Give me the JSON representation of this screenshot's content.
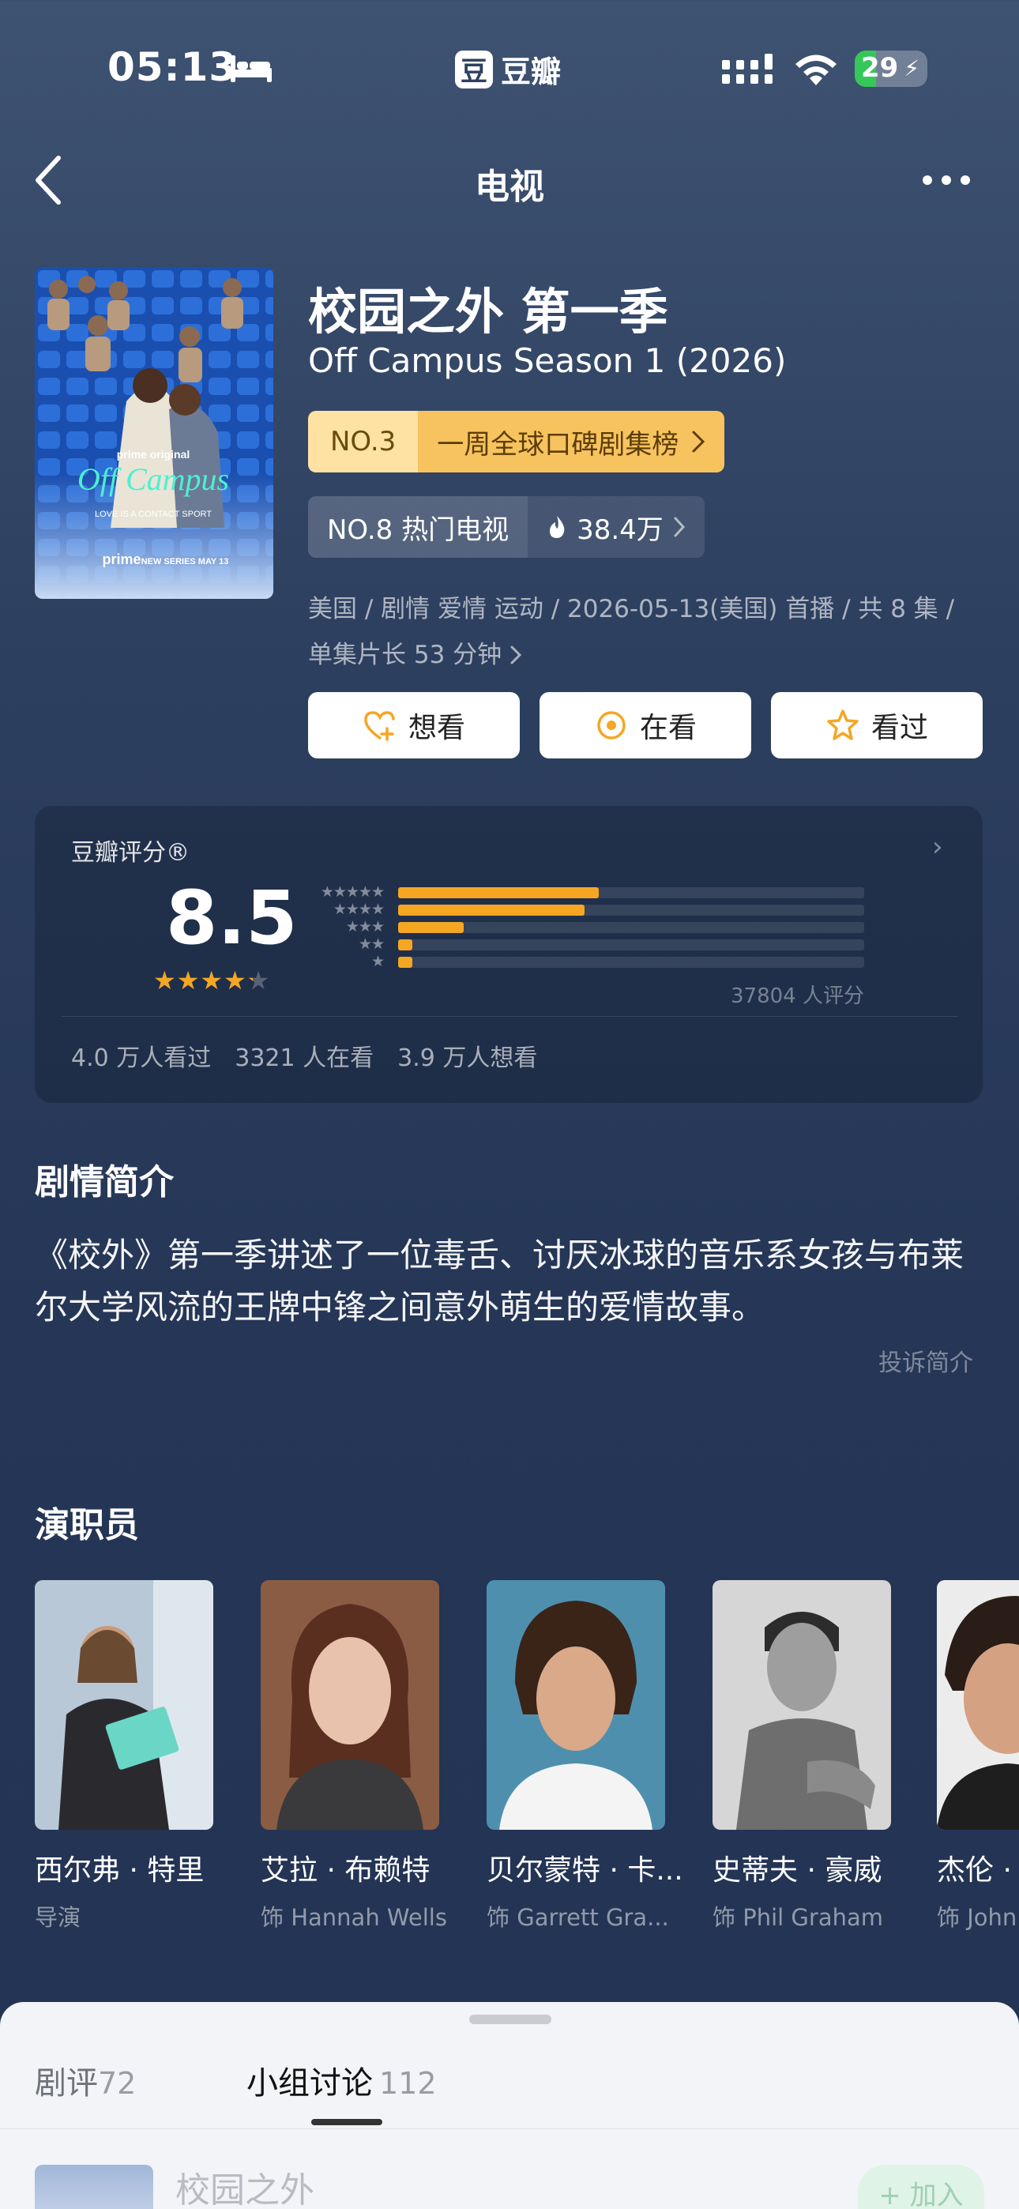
{
  "status_bar": {
    "time": "05:13",
    "app_name": "豆瓣",
    "app_logo": "豆",
    "battery": "29",
    "battery_level": 0.29
  },
  "nav": {
    "title": "电视"
  },
  "show": {
    "title_cn": "校园之外 第一季",
    "title_en": "Off Campus Season 1 (2026)",
    "rank1_no": "NO.3",
    "rank1_label": "一周全球口碑剧集榜",
    "rank2_no": "NO.8 热门电视",
    "rank2_heat": "38.4万",
    "meta_line1": "美国 / 剧情 爱情 运动 / 2026-05-13(美国) 首播 / 共 8 集 /",
    "meta_line2": "单集片长 53 分钟",
    "poster_brand": "prime original",
    "poster_title": "Off Campus",
    "poster_tagline": "LOVE IS A CONTACT SPORT",
    "poster_footer": "NEW SERIES MAY 13",
    "poster_logo": "prime"
  },
  "actions": {
    "want": "想看",
    "watching": "在看",
    "watched": "看过"
  },
  "rating": {
    "title": "豆瓣评分®",
    "score": "8.5",
    "stars": "★★★★★",
    "star_value": 4.25,
    "count": "37804 人评分",
    "distribution": [
      {
        "stars": "★★★★★",
        "percent": 43
      },
      {
        "stars": "★★★★",
        "percent": 40
      },
      {
        "stars": "★★★",
        "percent": 14
      },
      {
        "stars": "★★",
        "percent": 3
      },
      {
        "stars": "★",
        "percent": 3
      }
    ],
    "watched": "4.0 万人看过",
    "watching": "3321 人在看",
    "want": "3.9 万人想看"
  },
  "synopsis": {
    "title": "剧情简介",
    "text": "《校外》第一季讲述了一位毒舌、讨厌冰球的音乐系女孩与布莱尔大学风流的王牌中锋之间意外萌生的爱情故事。",
    "report": "投诉简介"
  },
  "cast": {
    "title": "演职员",
    "members": [
      {
        "name": "西尔弗 · 特里",
        "role": "导演"
      },
      {
        "name": "艾拉 · 布赖特",
        "role": "饰 Hannah Wells"
      },
      {
        "name": "贝尔蒙特 · 卡...",
        "role": "饰 Garrett Gra..."
      },
      {
        "name": "史蒂夫 · 豪威",
        "role": "饰 Phil Graham"
      },
      {
        "name": "杰伦 · 扌",
        "role": "饰 John"
      }
    ]
  },
  "bottom_sheet": {
    "tab_reviews": "剧评",
    "tab_reviews_count": "72",
    "tab_groups": "小组讨论",
    "tab_groups_count": "112",
    "group_name": "校园之外",
    "join": "+ 加入"
  },
  "colors": {
    "accent": "#f5a623",
    "background": "#2d3f5f",
    "rank_gold": "#f6c35f"
  }
}
